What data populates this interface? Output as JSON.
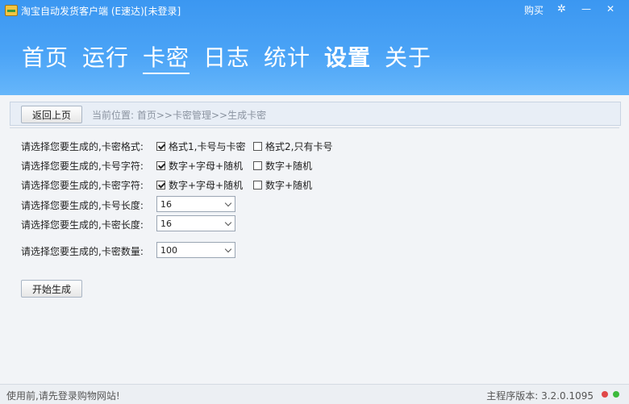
{
  "window": {
    "title": "淘宝自动发货客户端 (E速达)",
    "login_status": "[未登录]",
    "buy_label": "购买",
    "settings_glyph": "✲",
    "minimize_glyph": "—",
    "close_glyph": "✕"
  },
  "nav": {
    "items": [
      {
        "label": "首页"
      },
      {
        "label": "运行"
      },
      {
        "label": "卡密"
      },
      {
        "label": "日志"
      },
      {
        "label": "统计"
      },
      {
        "label": "设置"
      },
      {
        "label": "关于"
      }
    ],
    "current": "卡密"
  },
  "toolbar": {
    "back_label": "返回上页",
    "breadcrumb": "当前位置: 首页>>卡密管理>>生成卡密"
  },
  "form": {
    "format_label": "请选择您要生成的,卡密格式:",
    "format_opt1": "格式1,卡号与卡密",
    "format_opt2": "格式2,只有卡号",
    "card_chars_label": "请选择您要生成的,卡号字符:",
    "card_chars_opt1": "数字+字母+随机",
    "card_chars_opt2": "数字+随机",
    "pwd_chars_label": "请选择您要生成的,卡密字符:",
    "pwd_chars_opt1": "数字+字母+随机",
    "pwd_chars_opt2": "数字+随机",
    "card_len_label": "请选择您要生成的,卡号长度:",
    "card_len_value": "16",
    "pwd_len_label": "请选择您要生成的,卡密长度:",
    "pwd_len_value": "16",
    "count_label": "请选择您要生成的,卡密数量:",
    "count_value": "100",
    "start_label": "开始生成"
  },
  "status": {
    "left": "使用前,请先登录购物网站!",
    "version": "主程序版本: 3.2.0.1095",
    "dot1_color": "#e04848",
    "dot2_color": "#3cba3c"
  }
}
